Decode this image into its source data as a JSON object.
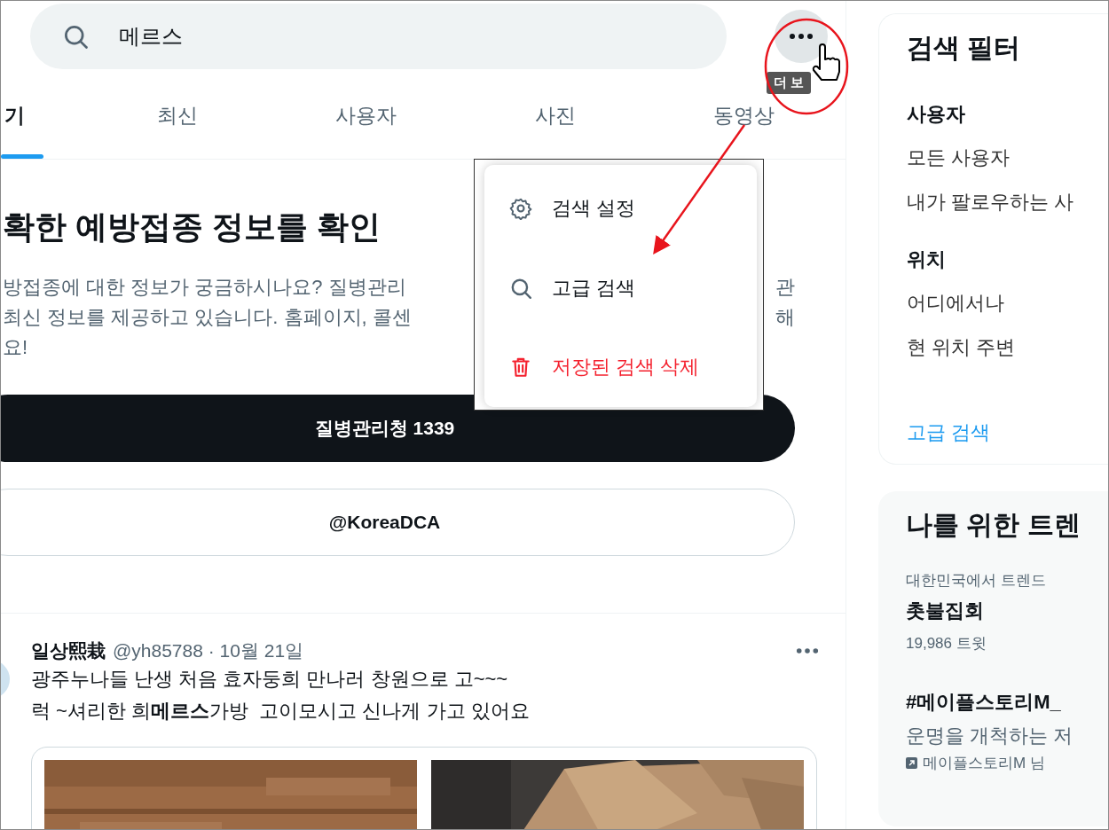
{
  "search": {
    "value": "메르스"
  },
  "tooltip": {
    "text": "더 보"
  },
  "tabs": [
    {
      "label": "기",
      "selected": true
    },
    {
      "label": "최신",
      "selected": false
    },
    {
      "label": "사용자",
      "selected": false
    },
    {
      "label": "사진",
      "selected": false
    },
    {
      "label": "동영상",
      "selected": false
    }
  ],
  "menu": {
    "items": [
      {
        "label": "검색 설정",
        "kind": "settings"
      },
      {
        "label": "고급 검색",
        "kind": "search"
      },
      {
        "label": "저장된 검색 삭제",
        "kind": "delete"
      }
    ]
  },
  "banner": {
    "title": "확한 예방접종 정보를 확인",
    "lines": [
      {
        "left": "방접종에 대한 정보가 궁금하시나요? 질병관리",
        "right": "관"
      },
      {
        "left": "최신 정보를 제공하고 있습니다. 홈페이지, 콜센",
        "right": "해"
      },
      {
        "left": "요!"
      }
    ],
    "buttons": [
      {
        "label": "질병관리청 1339",
        "kind": "primary"
      },
      {
        "label": "@KoreaDCA",
        "kind": "outline"
      }
    ]
  },
  "tweet": {
    "name": "일상熙栽",
    "meta": "@yh85788 · 10월 21일",
    "lines": [
      "광주누나들 난생 처음 효자둥희 만나러 창원으로 고~~~",
      "럭 ~셔리한 희**메르스**가방  고이모시고 신나게 가고 있어요"
    ],
    "media": [
      {
        "kind": "picture"
      },
      {
        "kind": "picture"
      }
    ]
  },
  "filters": {
    "title": "검색 필터",
    "sections": [
      {
        "heading": "사용자",
        "options": [
          "모든 사용자",
          "내가 팔로우하는 사"
        ]
      },
      {
        "heading": "위치",
        "options": [
          "어디에서나",
          "현 위치 주변"
        ]
      }
    ],
    "link": "고급 검색"
  },
  "trends": {
    "title": "나를 위한 트렌",
    "items": [
      {
        "context": "대한민국에서 트렌드",
        "name": "촛불집회",
        "count": "19,986 트윗"
      },
      {
        "name": "#메이플스토리M_",
        "description": "운명을 개척하는 저",
        "promoted": "메이플스토리M 님"
      }
    ]
  }
}
